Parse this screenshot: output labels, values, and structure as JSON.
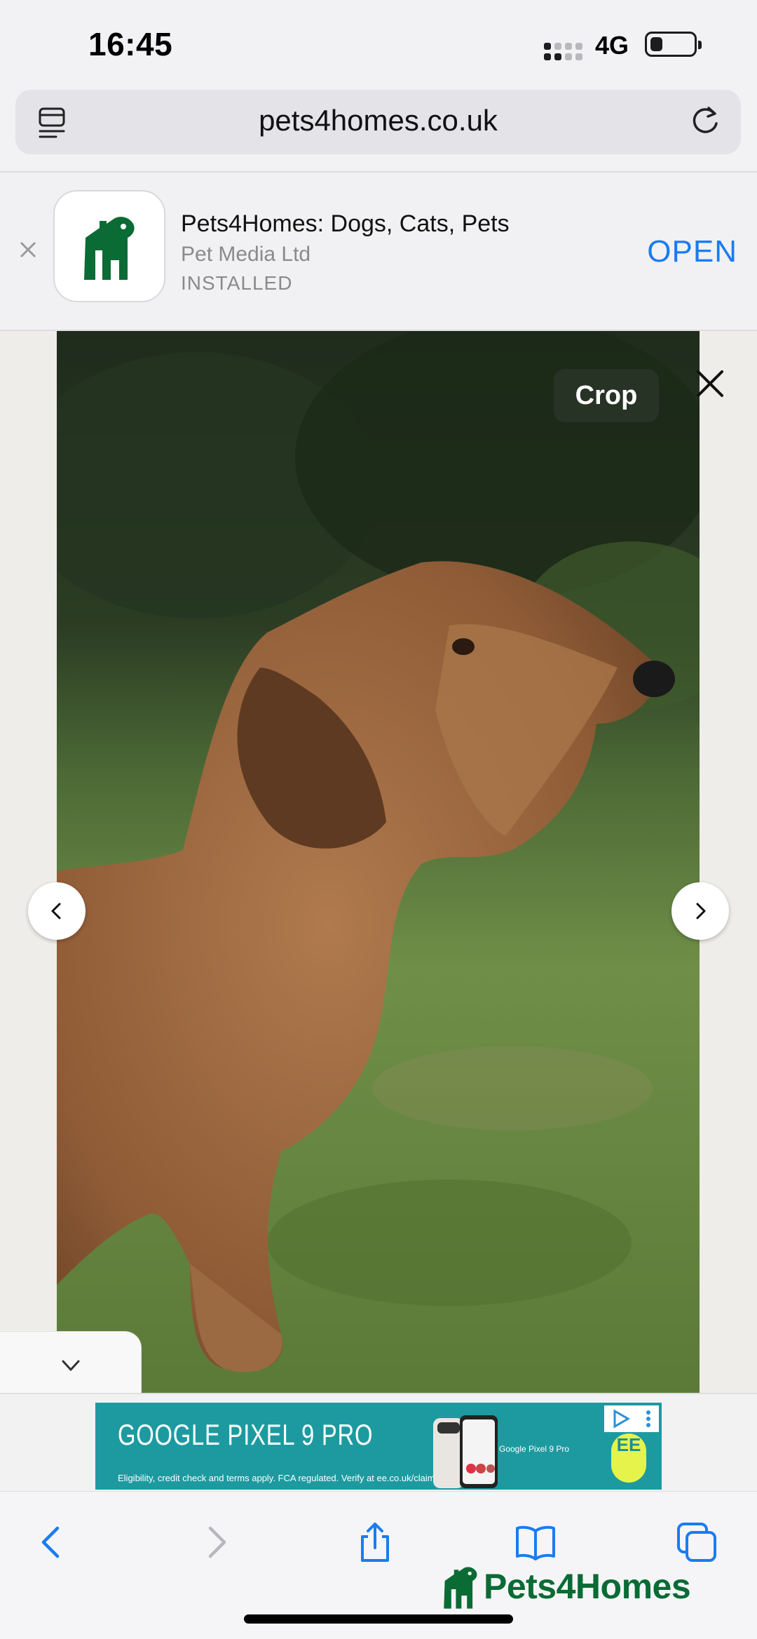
{
  "status_bar": {
    "time": "16:45",
    "network": "4G",
    "battery_level": 0.28
  },
  "browser": {
    "url": "pets4homes.co.uk"
  },
  "app_banner": {
    "name": "Pets4Homes: Dogs, Cats, Pets",
    "publisher": "Pet Media Ltd",
    "status": "INSTALLED",
    "open_label": "OPEN"
  },
  "gallery": {
    "crop_label": "Crop"
  },
  "ad": {
    "headline": "GOOGLE PIXEL 9 PRO",
    "fine_print": "Eligibility, credit check and terms apply. FCA regulated. Verify at ee.co.uk/claims",
    "product_label": "Google Pixel 9 Pro",
    "brand": "EE"
  },
  "footer": {
    "logo_text": "Pets4Homes"
  },
  "colors": {
    "accent": "#1a7cf0",
    "brand_green": "#0a6b34",
    "ad_teal": "#1d9aa0"
  }
}
